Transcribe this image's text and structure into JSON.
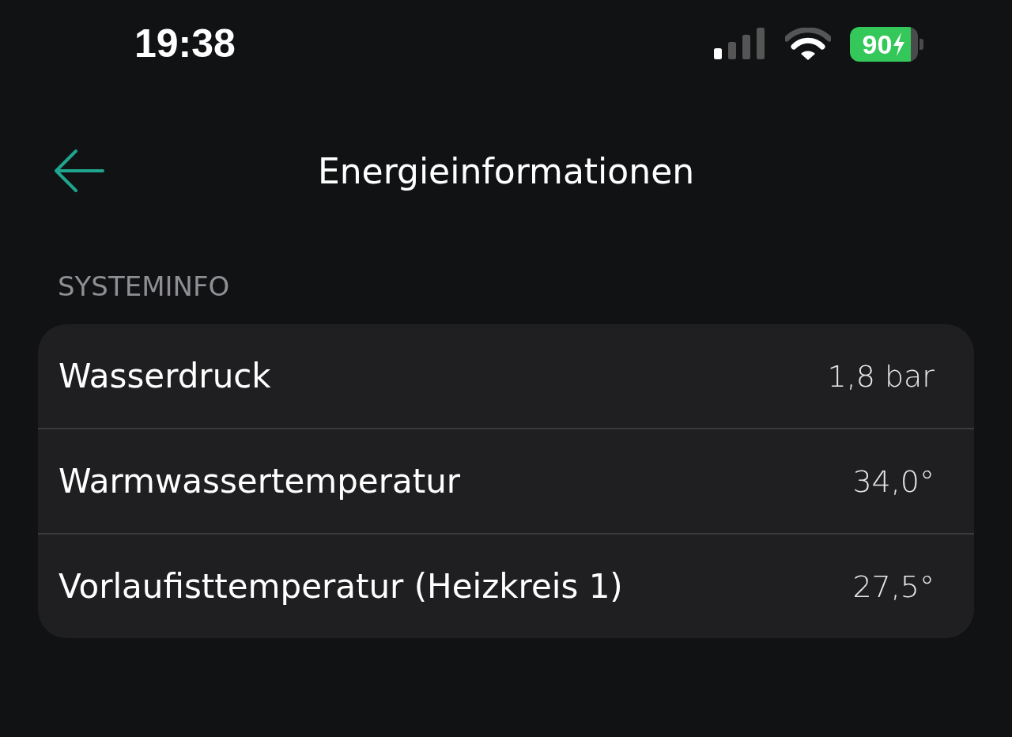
{
  "status_bar": {
    "time": "19:38",
    "battery": "90"
  },
  "header": {
    "title": "Energieinformationen"
  },
  "section": {
    "title": "SYSTEMINFO",
    "rows": [
      {
        "label": "Wasserdruck",
        "value": "1,8 bar"
      },
      {
        "label": "Warmwassertemperatur",
        "value": "34,0°"
      },
      {
        "label": "Vorlaufisttemperatur (Heizkreis 1)",
        "value": "27,5°"
      }
    ]
  }
}
